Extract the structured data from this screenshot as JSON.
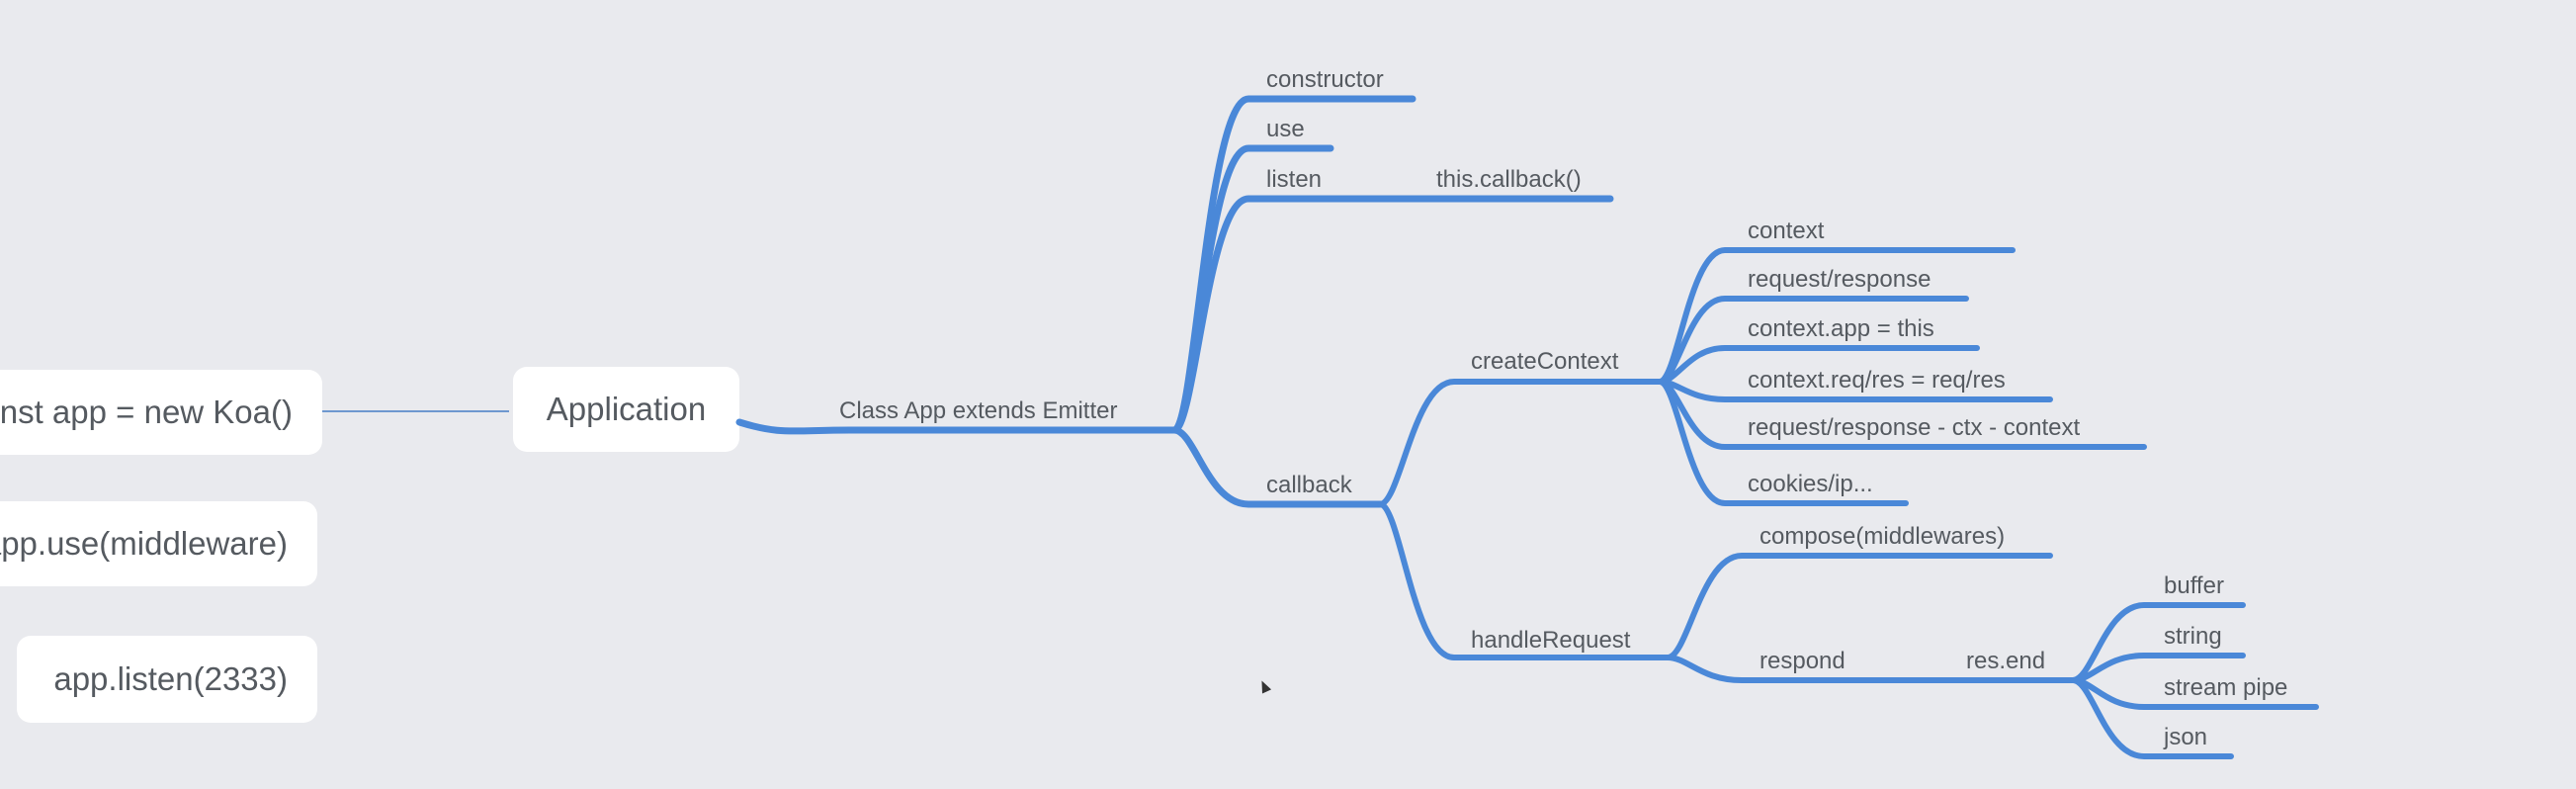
{
  "colors": {
    "background": "#e9eaee",
    "branch": "#4a88d8",
    "text": "#555a60",
    "node_fill": "#ffffff"
  },
  "side_nodes": [
    {
      "label": "const app = new Koa()"
    },
    {
      "label": "app.use(middleware)"
    },
    {
      "label": "app.listen(2333)"
    }
  ],
  "root": {
    "label": "Application"
  },
  "main_branch": {
    "label": "Class App extends Emitter"
  },
  "methods": {
    "constructor": "constructor",
    "use": "use",
    "listen": "listen",
    "listen_child": "this.callback()",
    "callback": "callback"
  },
  "createContext": {
    "label": "createContext",
    "children": [
      "context",
      "request/response",
      "context.app = this",
      "context.req/res = req/res",
      "request/response - ctx - context",
      "cookies/ip..."
    ]
  },
  "handleRequest": {
    "label": "handleRequest",
    "compose": "compose(middlewares)",
    "respond": "respond",
    "res_end": "res.end",
    "res_end_children": [
      "buffer",
      "string",
      "stream pipe",
      "json"
    ]
  }
}
